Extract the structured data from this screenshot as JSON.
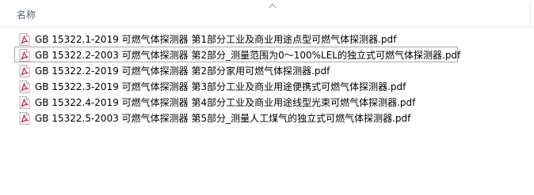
{
  "header": {
    "name_label": "名称"
  },
  "files": [
    {
      "name": "GB 15322.1-2019 可燃气体探测器 第1部分工业及商业用途点型可燃气体探测器.pdf"
    },
    {
      "name": "GB 15322.2-2003 可燃气体探测器 第2部分_测量范围为0～100%LEL的独立式可燃气体探测器.pdf"
    },
    {
      "name": "GB 15322.2-2019 可燃气体探测器 第2部分家用可燃气体探测器.pdf"
    },
    {
      "name": "GB 15322.3-2019 可燃气体探测器 第3部分工业及商业用途便携式可燃气体探测器.pdf"
    },
    {
      "name": "GB 15322.4-2019 可燃气体探测器 第4部分工业及商业用途线型光束可燃气体探测器.pdf"
    },
    {
      "name": "GB 15322.5-2003 可燃气体探测器 第5部分_测量人工煤气的独立式可燃气体探测器.pdf"
    }
  ],
  "icons": {
    "file_icon": "pdf-file-icon",
    "sort_icon": "chevron-up-icon"
  },
  "colors": {
    "header_text": "#4c607a",
    "pdf_red": "#d4231a",
    "focus_border": "#a8a8a8"
  }
}
